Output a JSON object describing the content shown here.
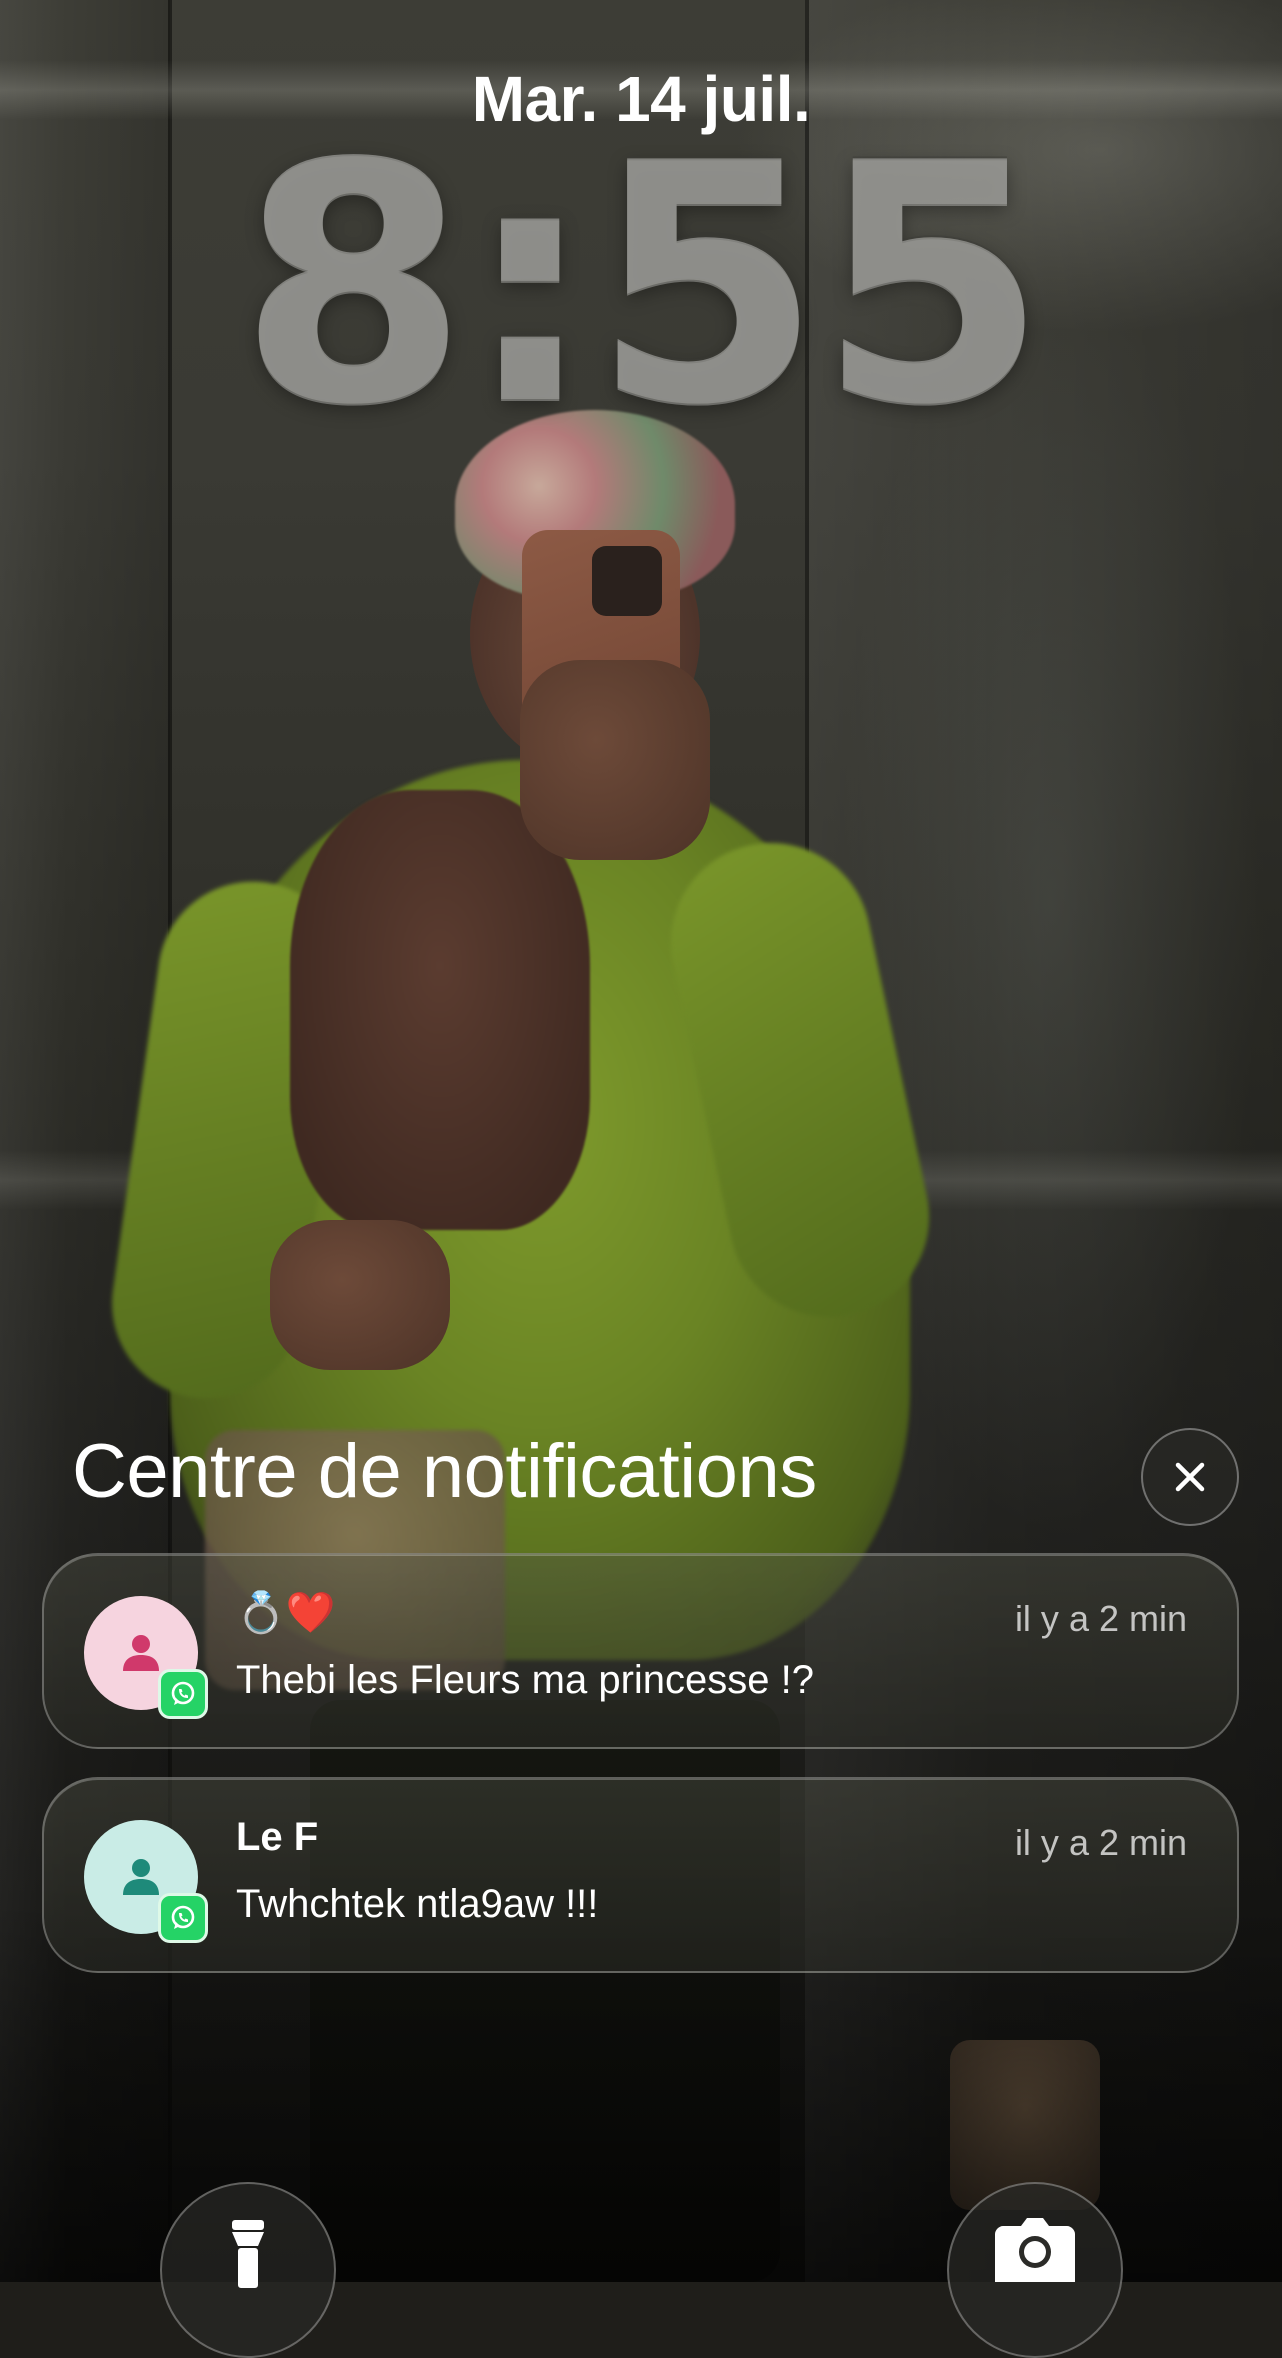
{
  "lock_screen": {
    "date": "Mar. 14 juil.",
    "time": "8:55"
  },
  "notification_center": {
    "title": "Centre de notifications",
    "close_icon": "close-icon"
  },
  "notifications": [
    {
      "sender": "💍❤️",
      "time": "il y a 2 min",
      "message": "Thebi les Fleurs ma princesse !?",
      "avatar_bg": "#f6d4df",
      "avatar_icon_color": "#d0396b",
      "app": "WhatsApp",
      "app_color": "#25d366"
    },
    {
      "sender": "Le F",
      "time": "il y a 2 min",
      "message": "Twhchtek ntla9aw !!!",
      "avatar_bg": "#c9ece6",
      "avatar_icon_color": "#1e8a7a",
      "app": "WhatsApp",
      "app_color": "#25d366"
    }
  ],
  "quick_actions": {
    "left_icon": "flashlight-icon",
    "right_icon": "camera-icon"
  }
}
